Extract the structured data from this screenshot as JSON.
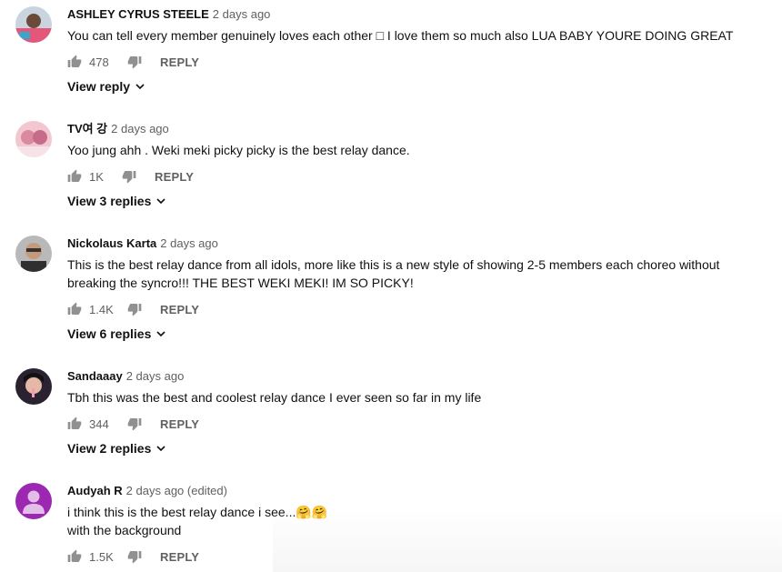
{
  "comments": [
    {
      "author": "ASHLEY CYRUS STEELE",
      "time": "2 days ago",
      "text": "You can tell every member genuinely loves each other □ I love them so much also LUA BABY YOURE DOING GREAT",
      "likes": "478",
      "reply_label": "REPLY",
      "view_replies": "View reply"
    },
    {
      "author": "TV여 강",
      "time": "2 days ago",
      "text": "Yoo jung ahh . Weki meki picky picky  is the best relay dance.",
      "likes": "1K",
      "reply_label": "REPLY",
      "view_replies": "View 3 replies"
    },
    {
      "author": "Nickolaus Karta",
      "time": "2 days ago",
      "text": "This is the best relay dance from all idols, more like this is a new style of showing 2-5 members each choreo without breaking the syncro!!! THE BEST WEKI MEKI! IM SO PICKY!",
      "likes": "1.4K",
      "reply_label": "REPLY",
      "view_replies": "View 6 replies"
    },
    {
      "author": "Sandaaay",
      "time": "2 days ago",
      "text": "Tbh this was the best and coolest relay dance I ever seen so far in my life",
      "likes": "344",
      "reply_label": "REPLY",
      "view_replies": "View 2 replies"
    },
    {
      "author": "Audyah R",
      "time": "2 days ago (edited)",
      "text": "i think this is the best relay dance i see...🤗🤗\nwith the background",
      "likes": "1.5K",
      "reply_label": "REPLY"
    }
  ],
  "icons": {
    "like": "thumb-up-icon",
    "dislike": "thumb-down-icon",
    "expand": "chevron-down-icon",
    "default_avatar": "person-icon"
  },
  "colors": {
    "default_avatar_bg": "#9c27b0"
  }
}
